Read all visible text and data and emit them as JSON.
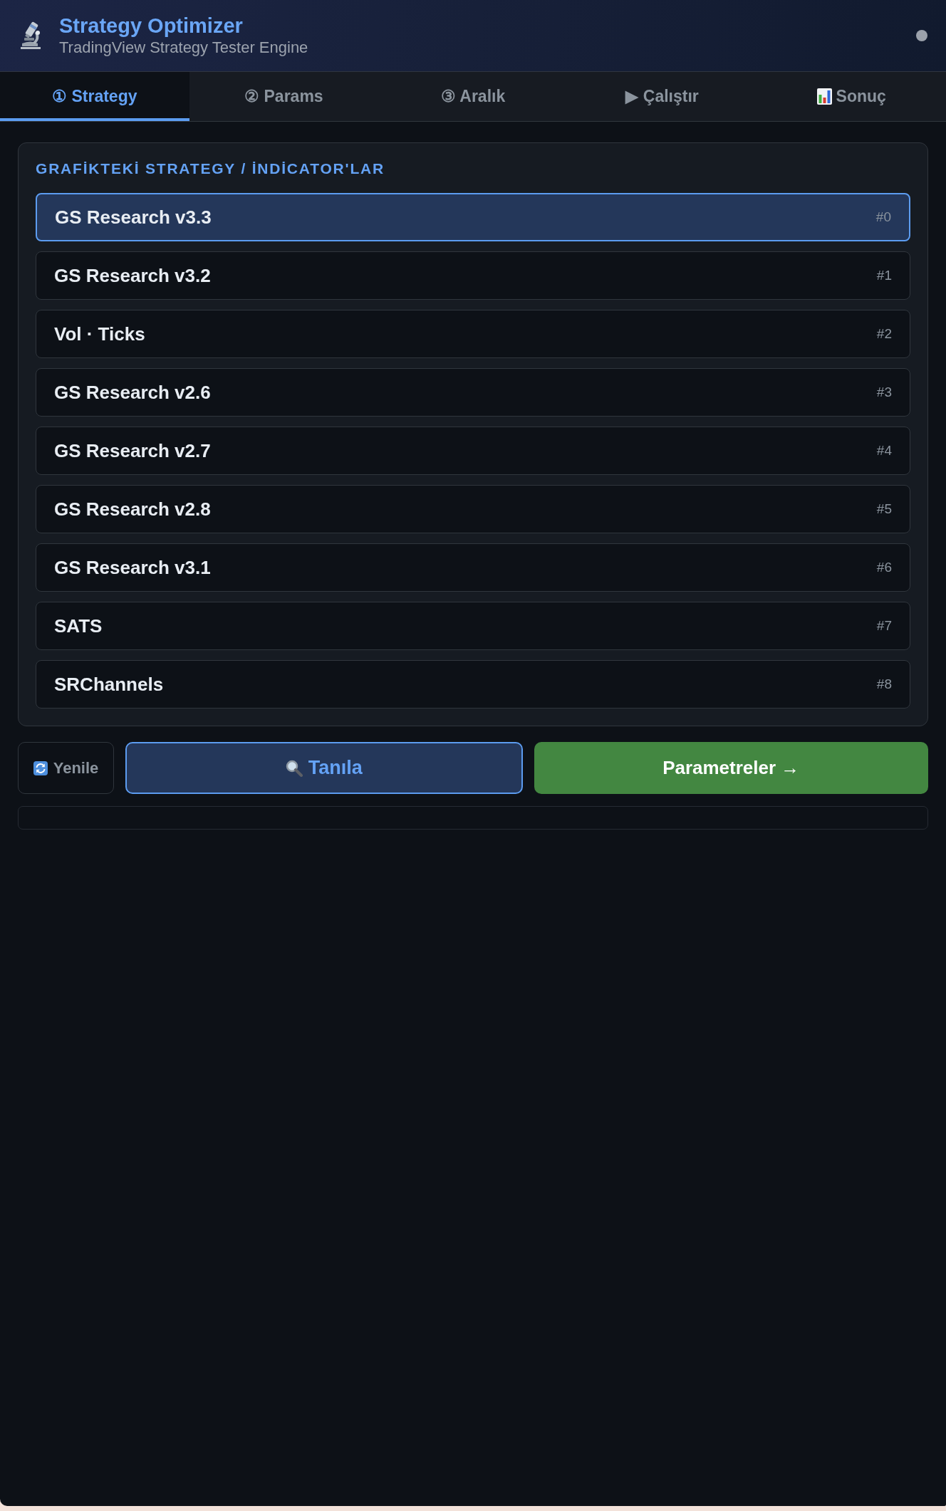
{
  "header": {
    "title": "Strategy Optimizer",
    "subtitle": "TradingView Strategy Tester Engine"
  },
  "tabs": [
    {
      "label": "① Strategy",
      "kind": "text",
      "selected": true
    },
    {
      "label": "② Params",
      "kind": "text",
      "selected": false
    },
    {
      "label": "③ Aralık",
      "kind": "text",
      "selected": false
    },
    {
      "label": "▶ Çalıştır",
      "kind": "text",
      "selected": false
    },
    {
      "label": "Sonuç",
      "kind": "chart",
      "selected": false
    }
  ],
  "strategies": {
    "heading": "GRAFİKTEKİ STRATEGY / İNDİCATOR'LAR",
    "items": [
      {
        "name": "GS Research v3.3",
        "index": "#0",
        "selected": true
      },
      {
        "name": "GS Research v3.2",
        "index": "#1",
        "selected": false
      },
      {
        "name": "Vol · Ticks",
        "index": "#2",
        "selected": false
      },
      {
        "name": "GS Research v2.6",
        "index": "#3",
        "selected": false
      },
      {
        "name": "GS Research v2.7",
        "index": "#4",
        "selected": false
      },
      {
        "name": "GS Research v2.8",
        "index": "#5",
        "selected": false
      },
      {
        "name": "GS Research v3.1",
        "index": "#6",
        "selected": false
      },
      {
        "name": "SATS",
        "index": "#7",
        "selected": false
      },
      {
        "name": "SRChannels",
        "index": "#8",
        "selected": false
      }
    ]
  },
  "actions": [
    {
      "label": "Yenile",
      "kind": "refresh"
    },
    {
      "label": "Tanıla",
      "kind": "diagnose"
    },
    {
      "label": "Parametreler →",
      "kind": "proceed"
    }
  ]
}
